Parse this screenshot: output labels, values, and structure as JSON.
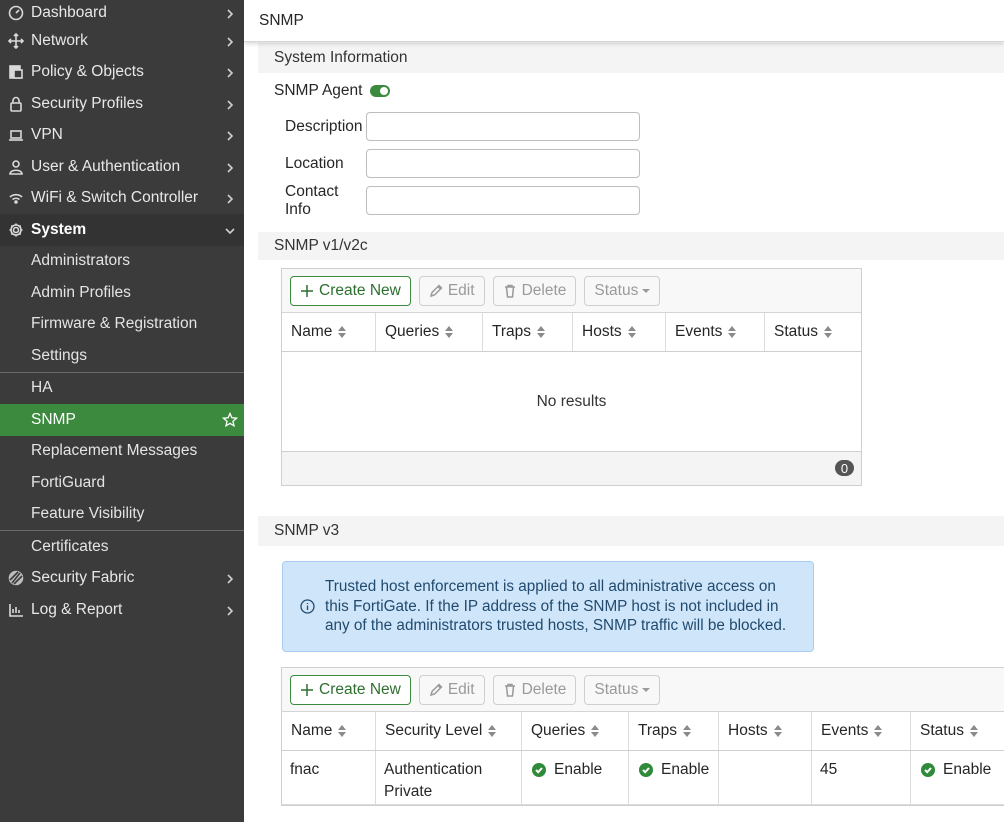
{
  "sidebar": {
    "top_items": [
      {
        "label": "Dashboard",
        "icon": "dashboard-icon"
      },
      {
        "label": "Network",
        "icon": "network-icon"
      },
      {
        "label": "Policy & Objects",
        "icon": "policy-icon"
      },
      {
        "label": "Security Profiles",
        "icon": "lock-icon"
      },
      {
        "label": "VPN",
        "icon": "laptop-icon"
      },
      {
        "label": "User & Authentication",
        "icon": "user-icon"
      },
      {
        "label": "WiFi & Switch Controller",
        "icon": "wifi-icon"
      }
    ],
    "system": {
      "label": "System",
      "icon": "gear-icon"
    },
    "system_items_group1": [
      "Administrators",
      "Admin Profiles",
      "Firmware & Registration",
      "Settings"
    ],
    "system_items_group2": [
      "HA",
      "SNMP",
      "Replacement Messages",
      "FortiGuard",
      "Feature Visibility"
    ],
    "system_items_group3": [
      "Certificates"
    ],
    "bottom_items": [
      {
        "label": "Security Fabric",
        "icon": "security-fabric-icon"
      },
      {
        "label": "Log & Report",
        "icon": "log-report-icon"
      }
    ],
    "active_item": "SNMP"
  },
  "header": {
    "title": "SNMP"
  },
  "system_info": {
    "heading": "System Information",
    "agent_label": "SNMP Agent",
    "agent_enabled": true,
    "fields": [
      {
        "label": "Description",
        "value": ""
      },
      {
        "label": "Location",
        "value": ""
      },
      {
        "label": "Contact Info",
        "value": ""
      }
    ]
  },
  "v1v2c": {
    "heading": "SNMP v1/v2c",
    "toolbar": {
      "create": "Create New",
      "edit": "Edit",
      "delete": "Delete",
      "status": "Status"
    },
    "columns": [
      "Name",
      "Queries",
      "Traps",
      "Hosts",
      "Events",
      "Status"
    ],
    "empty_text": "No results",
    "count": "0"
  },
  "v3": {
    "heading": "SNMP v3",
    "notice": "Trusted host enforcement is applied to all administrative access on this FortiGate. If the IP address of the SNMP host is not included in any of the administrators trusted hosts, SNMP traffic will be blocked.",
    "toolbar": {
      "create": "Create New",
      "edit": "Edit",
      "delete": "Delete",
      "status": "Status"
    },
    "columns": [
      "Name",
      "Security Level",
      "Queries",
      "Traps",
      "Hosts",
      "Events",
      "Status"
    ],
    "rows": [
      {
        "name": "fnac",
        "security_level_line1": "Authentication",
        "security_level_line2": "Private",
        "queries": "Enable",
        "traps": "Enable",
        "hosts": "",
        "events": "45",
        "status": "Enable"
      }
    ]
  },
  "colors": {
    "accent": "#3c8a3e",
    "sidebar": "#3b3b3b",
    "info_bg": "#cfe6fa",
    "ok": "#2f8a3a"
  }
}
